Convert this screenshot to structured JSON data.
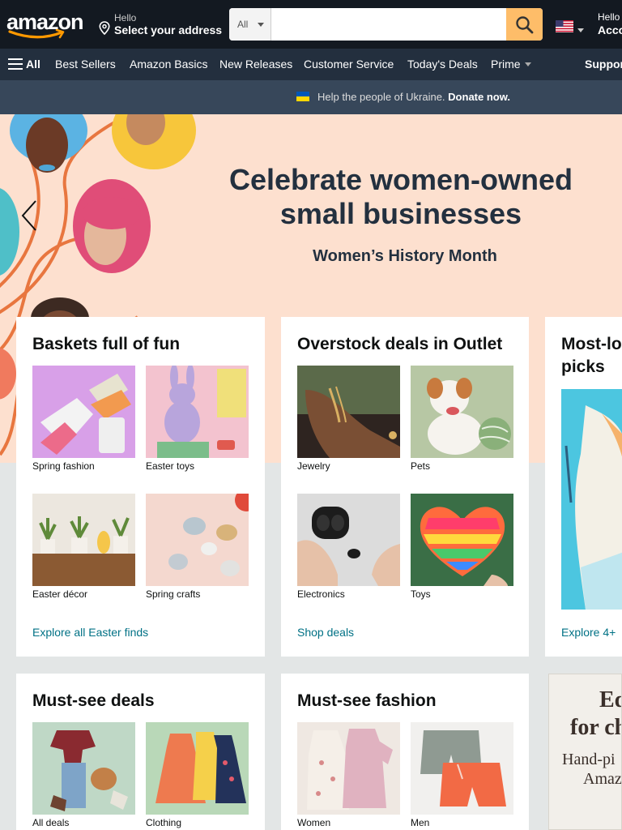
{
  "header": {
    "logo_text": "amazon",
    "address": {
      "hello": "Hello",
      "select": "Select your address"
    },
    "search": {
      "category": "All",
      "placeholder": ""
    },
    "account": {
      "hello": "Hello",
      "label": "Acco"
    }
  },
  "subnav": {
    "all": "All",
    "links": [
      "Best Sellers",
      "Amazon Basics",
      "New Releases",
      "Customer Service",
      "Today's Deals",
      "Prime",
      "Suppor"
    ]
  },
  "banner": {
    "text": "Help the people of Ukraine.",
    "cta": "Donate now."
  },
  "hero": {
    "title": "Celebrate women-owned small businesses",
    "subtitle": "Women’s History Month"
  },
  "cards": [
    {
      "title": "Baskets full of fun",
      "tiles": [
        "Spring fashion",
        "Easter toys",
        "Easter décor",
        "Spring crafts"
      ],
      "link": "Explore all Easter finds"
    },
    {
      "title": "Overstock deals in Outlet",
      "tiles": [
        "Jewelry",
        "Pets",
        "Electronics",
        "Toys"
      ],
      "link": "Shop deals"
    },
    {
      "title": "Most-lo",
      "title2": "picks",
      "link": "Explore 4+"
    },
    {
      "title": "Must-see deals",
      "tiles": [
        "All deals",
        "Clothing"
      ]
    },
    {
      "title": "Must-see fashion",
      "tiles": [
        "Women",
        "Men"
      ]
    },
    {
      "ad_line1": "Ed",
      "ad_line2": "for ch",
      "ad_line3": "Hand-pi",
      "ad_line4": "Amaz"
    }
  ],
  "colors": {
    "nav_dark": "#131921",
    "nav_sub": "#232f3e",
    "banner": "#37475a",
    "search_button": "#febd69",
    "link": "#007185",
    "hero_bg": "#fde0cf"
  }
}
